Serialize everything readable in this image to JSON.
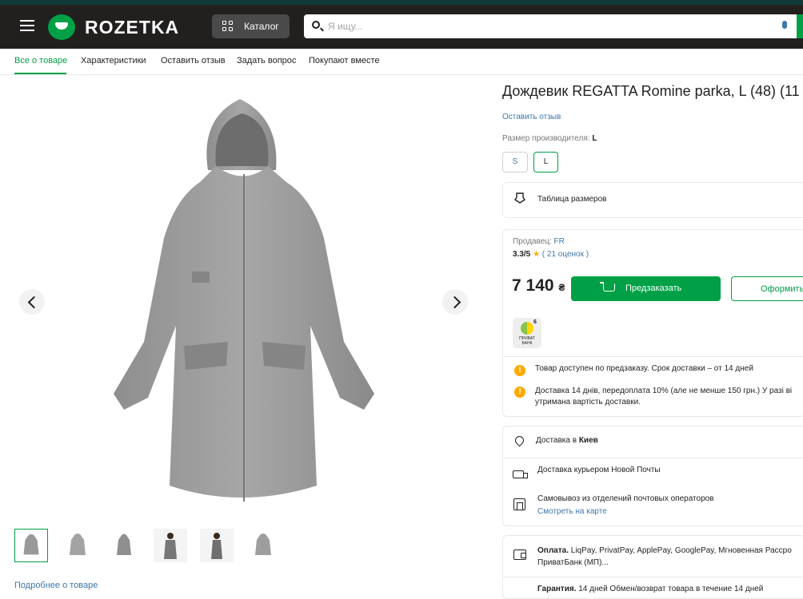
{
  "header": {
    "logo_text": "ROZETKA",
    "catalog_label": "Каталог",
    "search_placeholder": "Я ищу..."
  },
  "tabs": [
    {
      "label": "Все о товаре",
      "active": true
    },
    {
      "label": "Характеристики"
    },
    {
      "label": "Оставить отзыв"
    },
    {
      "label": "Задать вопрос"
    },
    {
      "label": "Покупают вместе"
    }
  ],
  "gallery": {
    "thumb_count": 6,
    "active_thumb": 0,
    "more_link": "Подробнее о товаре"
  },
  "product": {
    "title": "Дождевик REGATTA Romine parka, L (48) (11",
    "review_link": "Оставить отзыв",
    "size_label": "Размер производителя:",
    "size_value": "L",
    "sizes": [
      "S",
      "L"
    ],
    "selected_size": "L",
    "size_table": "Таблица размеров",
    "seller_label": "Продавец:",
    "seller_name": "FR",
    "rating": "3.3/5",
    "rating_count": "( 21 оценок )",
    "price": "7 140",
    "currency": "₴",
    "buy_label": "Предзаказать",
    "order_label": "Оформить",
    "privat_number": "6",
    "privat_text": "ПРИВАТ БАНК",
    "notes": [
      "Товар доступен по предзаказу. Срок доставки – от 14 дней",
      "Доставка 14 днів, передоплата 10% (але не менше 150 грн.) У разі ві",
      "утримана вартість доставки."
    ]
  },
  "delivery": {
    "label": "Доставка в",
    "city": "Киев",
    "courier": "Доставка курьером Новой Почты",
    "pickup": "Самовывоз из отделений почтовых операторов",
    "map_link": "Смотреть на карте"
  },
  "payment": {
    "label": "Оплата.",
    "line1": " LiqPay, PrivatPay, ApplePay, GooglePay, Мгновенная Рассро",
    "line2": "ПриватБанк (МП)...",
    "guarantee_label": "Гарантия.",
    "guarantee_text": " 14 дней Обмен/возврат товара в течение 14 дней"
  },
  "colors": {
    "header_bg": "#221f1f",
    "accent": "#00a046",
    "link": "#3e77aa",
    "warning": "#ffa900"
  }
}
